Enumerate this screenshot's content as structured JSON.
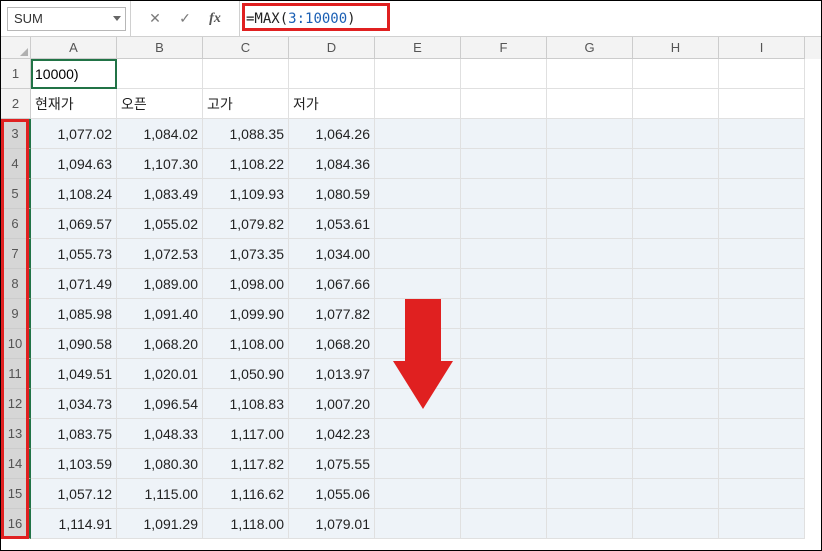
{
  "formula_bar": {
    "namebox_value": "SUM",
    "formula_prefix": "=MAX(",
    "formula_arg": "3:10000",
    "formula_suffix": ")"
  },
  "columns": [
    "A",
    "B",
    "C",
    "D",
    "E",
    "F",
    "G",
    "H",
    "I"
  ],
  "rows": [
    "1",
    "2",
    "3",
    "4",
    "5",
    "6",
    "7",
    "8",
    "9",
    "10",
    "11",
    "12",
    "13",
    "14",
    "15",
    "16"
  ],
  "active_cell_display": "10000)",
  "headers_row2": {
    "A": "현재가",
    "B": "오픈",
    "C": "고가",
    "D": "저가"
  },
  "data": [
    {
      "A": "1,077.02",
      "B": "1,084.02",
      "C": "1,088.35",
      "D": "1,064.26"
    },
    {
      "A": "1,094.63",
      "B": "1,107.30",
      "C": "1,108.22",
      "D": "1,084.36"
    },
    {
      "A": "1,108.24",
      "B": "1,083.49",
      "C": "1,109.93",
      "D": "1,080.59"
    },
    {
      "A": "1,069.57",
      "B": "1,055.02",
      "C": "1,079.82",
      "D": "1,053.61"
    },
    {
      "A": "1,055.73",
      "B": "1,072.53",
      "C": "1,073.35",
      "D": "1,034.00"
    },
    {
      "A": "1,071.49",
      "B": "1,089.00",
      "C": "1,098.00",
      "D": "1,067.66"
    },
    {
      "A": "1,085.98",
      "B": "1,091.40",
      "C": "1,099.90",
      "D": "1,077.82"
    },
    {
      "A": "1,090.58",
      "B": "1,068.20",
      "C": "1,108.00",
      "D": "1,068.20"
    },
    {
      "A": "1,049.51",
      "B": "1,020.01",
      "C": "1,050.90",
      "D": "1,013.97"
    },
    {
      "A": "1,034.73",
      "B": "1,096.54",
      "C": "1,108.83",
      "D": "1,007.20"
    },
    {
      "A": "1,083.75",
      "B": "1,048.33",
      "C": "1,117.00",
      "D": "1,042.23"
    },
    {
      "A": "1,103.59",
      "B": "1,080.30",
      "C": "1,117.82",
      "D": "1,075.55"
    },
    {
      "A": "1,057.12",
      "B": "1,115.00",
      "C": "1,116.62",
      "D": "1,055.06"
    },
    {
      "A": "1,114.91",
      "B": "1,091.29",
      "C": "1,118.00",
      "D": "1,079.01"
    }
  ],
  "annotations": {
    "arrow_meaning": "rows-continue-down-icon"
  }
}
